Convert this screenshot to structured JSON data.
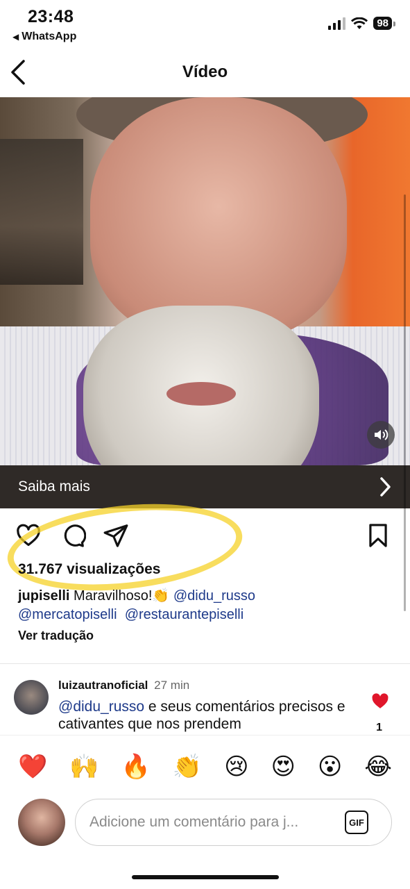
{
  "status_bar": {
    "time": "23:48",
    "back_app": "WhatsApp",
    "battery": "98"
  },
  "header": {
    "title": "Vídeo"
  },
  "video": {
    "learn_more_label": "Saiba mais"
  },
  "post": {
    "views": "31.767 visualizações",
    "caption_user": "jupiselli",
    "caption_text": "Maravilhoso!👏",
    "mentions": [
      "@didu_russo",
      "@mercatopiselli",
      "@restaurantepiselli"
    ],
    "see_translation": "Ver tradução"
  },
  "comment": {
    "username": "luizautranoficial",
    "time": "27 min",
    "mention": "@didu_russo",
    "text": "e seus comentários precisos e cativantes que nos prendem",
    "like_count": "1"
  },
  "reactions": [
    "❤️",
    "🙌",
    "🔥",
    "👏",
    "😢",
    "😍",
    "😮",
    "😂"
  ],
  "composer": {
    "placeholder": "Adicione um comentário para j...",
    "gif_label": "GIF"
  },
  "colors": {
    "highlight": "#f5d228",
    "like_red": "#e0162b",
    "mention_blue": "#1e3a8a",
    "learn_more_bg": "#2f2a27"
  }
}
